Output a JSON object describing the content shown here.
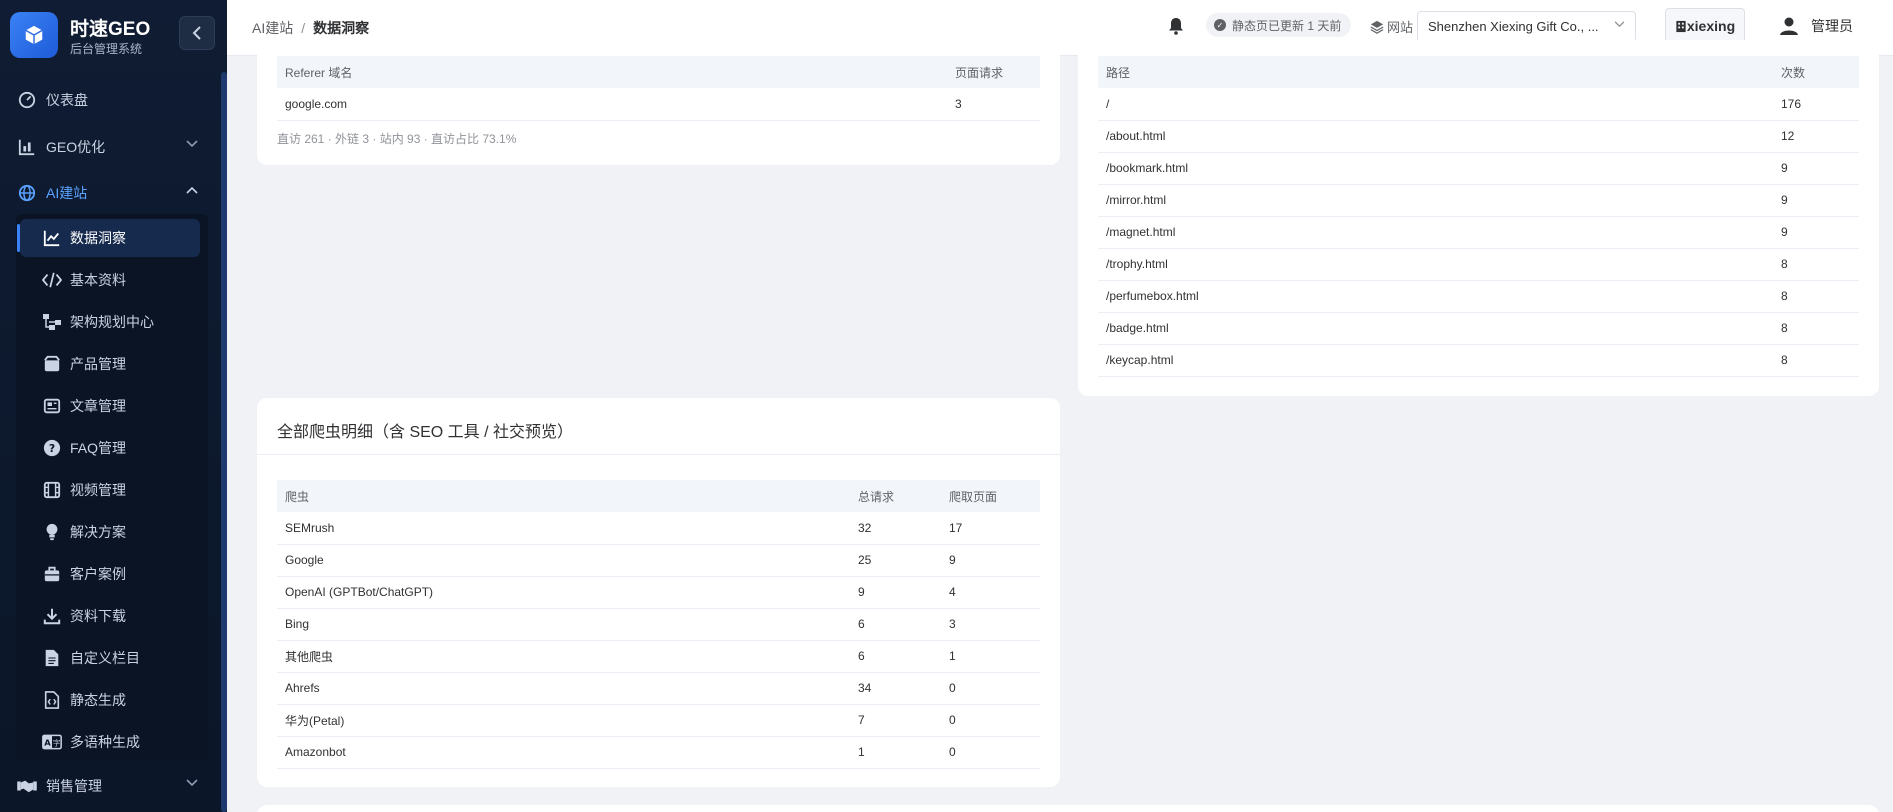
{
  "brand": {
    "title": "时速GEO",
    "subtitle": "后台管理系统"
  },
  "sidebar": {
    "items": [
      {
        "label": "仪表盘",
        "icon": "dashboard-icon"
      },
      {
        "label": "GEO优化",
        "icon": "chart-bars-icon"
      },
      {
        "label": "AI建站",
        "icon": "globe-icon"
      },
      {
        "label": "销售管理",
        "icon": "handshake-icon"
      }
    ],
    "sub_items": [
      {
        "label": "数据洞察",
        "icon": "line-chart-icon"
      },
      {
        "label": "基本资料",
        "icon": "code-icon"
      },
      {
        "label": "架构规划中心",
        "icon": "sitemap-icon"
      },
      {
        "label": "产品管理",
        "icon": "box-icon"
      },
      {
        "label": "文章管理",
        "icon": "newspaper-icon"
      },
      {
        "label": "FAQ管理",
        "icon": "question-icon"
      },
      {
        "label": "视频管理",
        "icon": "film-icon"
      },
      {
        "label": "解决方案",
        "icon": "lightbulb-icon"
      },
      {
        "label": "客户案例",
        "icon": "briefcase-icon"
      },
      {
        "label": "资料下载",
        "icon": "download-icon"
      },
      {
        "label": "自定义栏目",
        "icon": "file-icon"
      },
      {
        "label": "静态生成",
        "icon": "file-code-icon"
      },
      {
        "label": "多语种生成",
        "icon": "language-icon"
      }
    ]
  },
  "header": {
    "breadcrumb": [
      "AI建站",
      "数据洞察"
    ],
    "separator": "/",
    "status": "静态页已更新 1 天前",
    "site_label": "网站",
    "site_value": "Shenzhen Xiexing Gift Co., ...",
    "org_button": "xiexing",
    "user_name": "管理员"
  },
  "referer_table": {
    "columns": [
      "Referer 域名",
      "页面请求"
    ],
    "rows": [
      [
        "google.com",
        "3"
      ]
    ],
    "footnote": "直访 261 · 外链 3 · 站内 93 · 直访占比 73.1%"
  },
  "path_table": {
    "columns": [
      "路径",
      "次数"
    ],
    "rows": [
      [
        "/",
        "176"
      ],
      [
        "/about.html",
        "12"
      ],
      [
        "/bookmark.html",
        "9"
      ],
      [
        "/mirror.html",
        "9"
      ],
      [
        "/magnet.html",
        "9"
      ],
      [
        "/trophy.html",
        "8"
      ],
      [
        "/perfumebox.html",
        "8"
      ],
      [
        "/badge.html",
        "8"
      ],
      [
        "/keycap.html",
        "8"
      ]
    ]
  },
  "crawler_card": {
    "title": "全部爬虫明细（含 SEO 工具 / 社交预览）",
    "columns": [
      "爬虫",
      "总请求",
      "爬取页面"
    ],
    "rows": [
      [
        "SEMrush",
        "32",
        "17"
      ],
      [
        "Google",
        "25",
        "9"
      ],
      [
        "OpenAI (GPTBot/ChatGPT)",
        "9",
        "4"
      ],
      [
        "Bing",
        "6",
        "3"
      ],
      [
        "其他爬虫",
        "6",
        "1"
      ],
      [
        "Ahrefs",
        "34",
        "0"
      ],
      [
        "华为(Petal)",
        "7",
        "0"
      ],
      [
        "Amazonbot",
        "1",
        "0"
      ]
    ]
  },
  "colors": {
    "accent": "#3b82f6",
    "sidebar_bg": "#0f1c33",
    "active_text": "#5aa2ff"
  }
}
